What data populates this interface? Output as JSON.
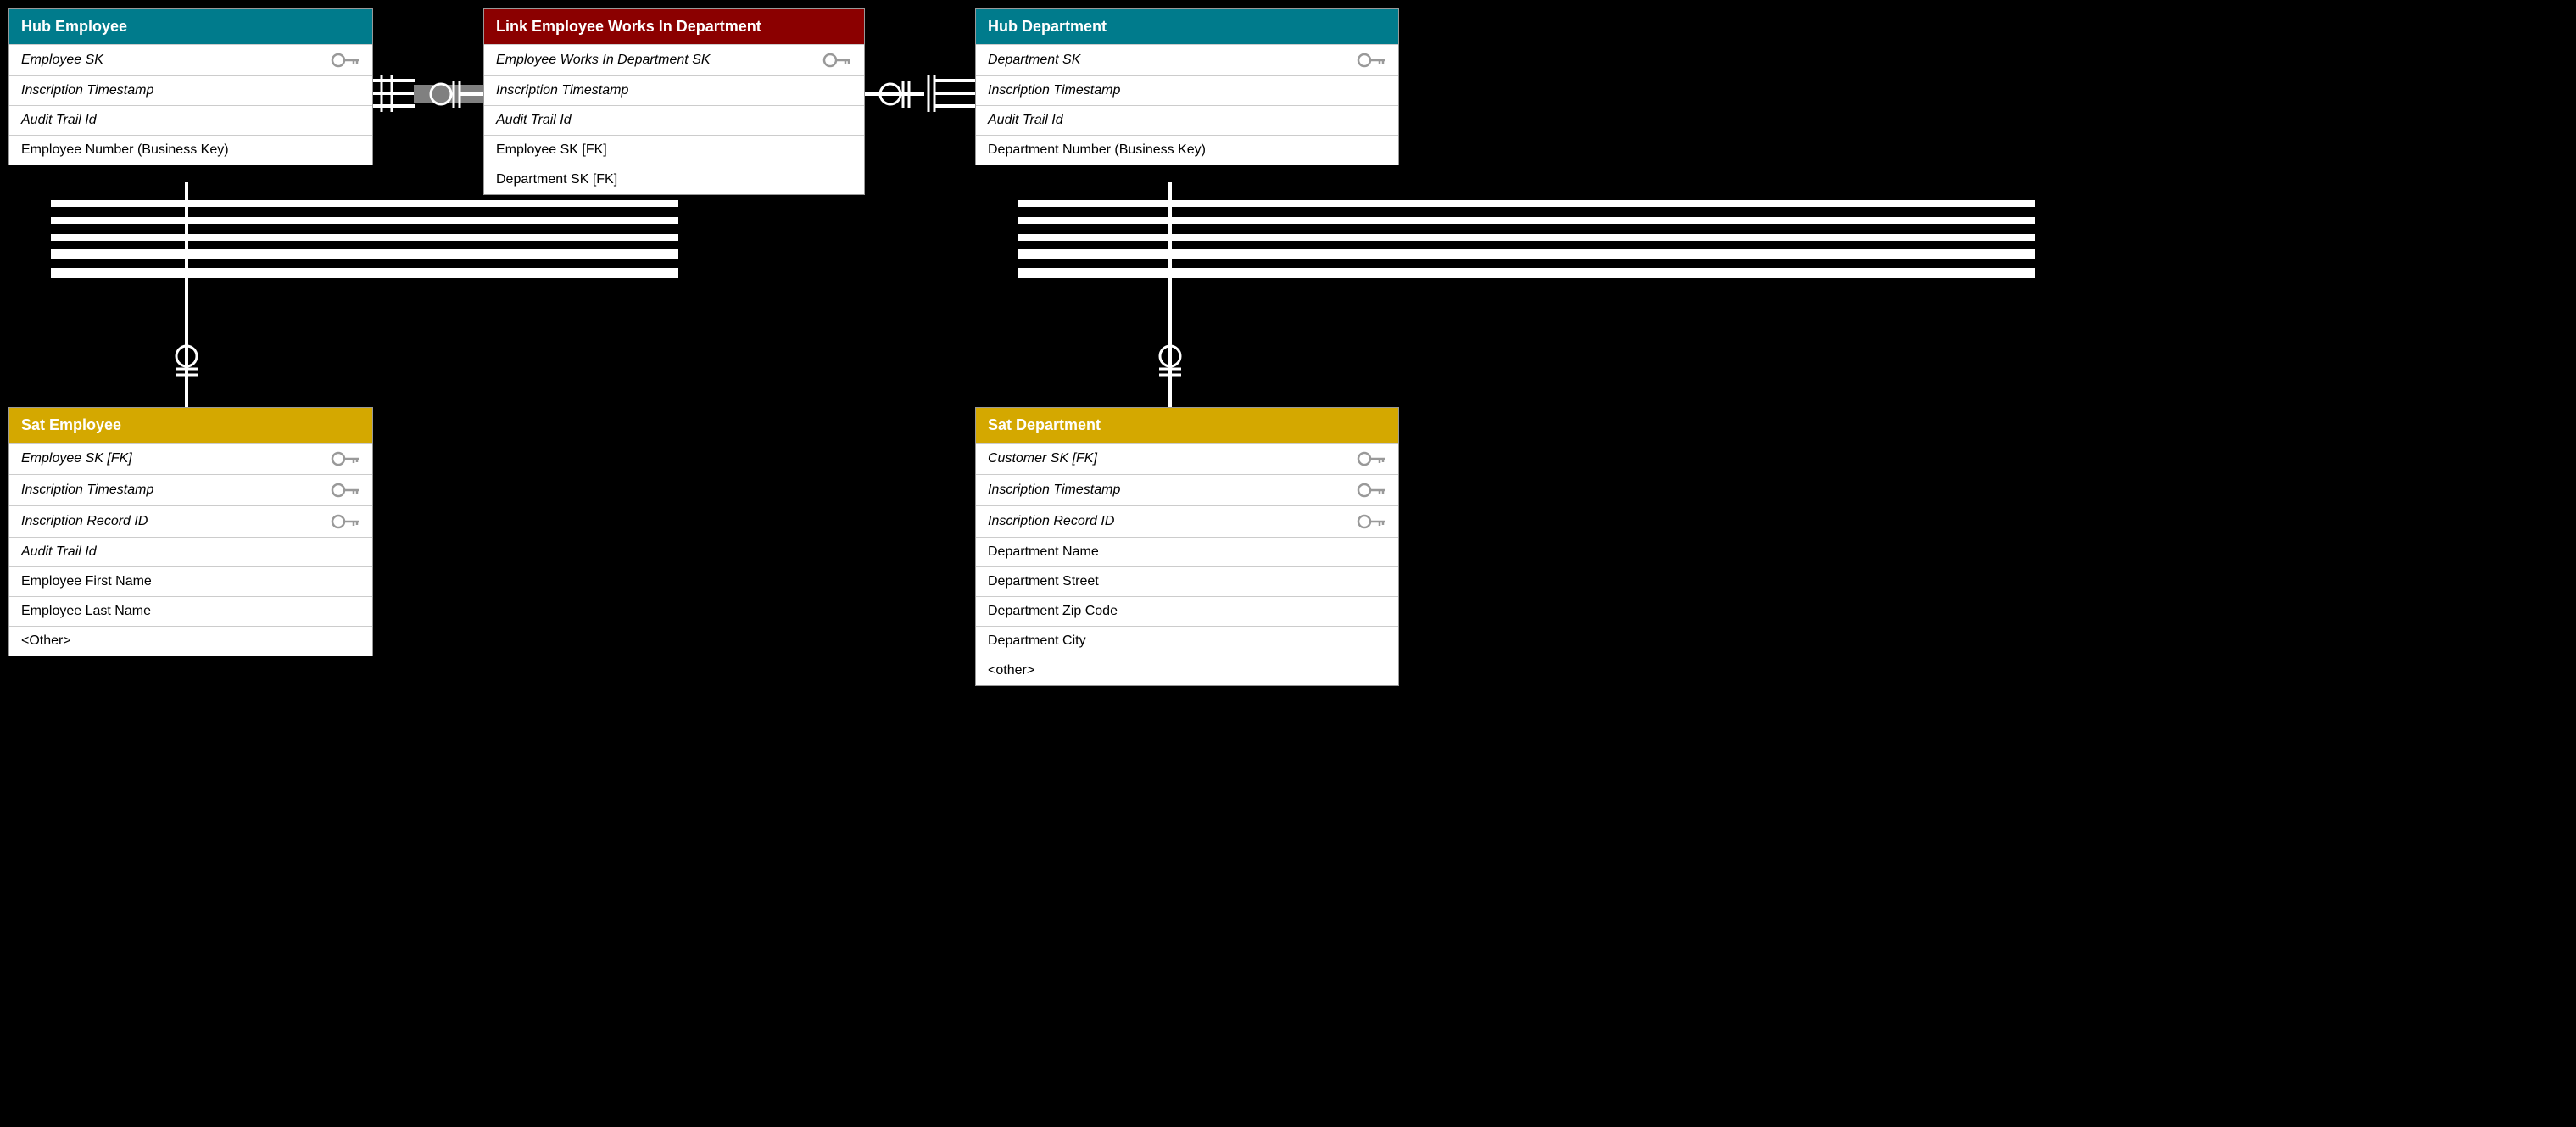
{
  "hubEmployee": {
    "title": "Hub Employee",
    "headerColor": "#007b8c",
    "fields": [
      {
        "label": "Employee SK",
        "hasKey": true
      },
      {
        "label": "Inscription Timestamp",
        "hasKey": false
      },
      {
        "label": "Audit Trail Id",
        "hasKey": false
      },
      {
        "label": "Employee Number (Business Key)",
        "hasKey": false,
        "normal": true
      }
    ]
  },
  "linkEmployee": {
    "title": "Link Employee Works In Department",
    "headerColor": "#8b0000",
    "fields": [
      {
        "label": "Employee Works In Department SK",
        "hasKey": true
      },
      {
        "label": "Inscription Timestamp",
        "hasKey": false
      },
      {
        "label": "Audit Trail Id",
        "hasKey": false
      },
      {
        "label": "Employee SK [FK]",
        "hasKey": false,
        "normal": true
      },
      {
        "label": "Department SK [FK]",
        "hasKey": false,
        "normal": true
      }
    ]
  },
  "hubDepartment": {
    "title": "Hub Department",
    "headerColor": "#007b8c",
    "fields": [
      {
        "label": "Department SK",
        "hasKey": true
      },
      {
        "label": "Inscription Timestamp",
        "hasKey": false
      },
      {
        "label": "Audit Trail Id",
        "hasKey": false
      },
      {
        "label": "Department Number (Business Key)",
        "hasKey": false,
        "normal": true
      }
    ]
  },
  "satEmployee": {
    "title": "Sat Employee",
    "headerColor": "#d4a800",
    "fields": [
      {
        "label": "Employee SK [FK]",
        "hasKey": true
      },
      {
        "label": "Inscription Timestamp",
        "hasKey": true
      },
      {
        "label": "Inscription Record ID",
        "hasKey": true
      },
      {
        "label": "Audit Trail Id",
        "hasKey": false
      },
      {
        "label": "Employee First Name",
        "hasKey": false,
        "normal": true
      },
      {
        "label": "Employee Last Name",
        "hasKey": false,
        "normal": true
      },
      {
        "label": "<Other>",
        "hasKey": false,
        "normal": true
      }
    ]
  },
  "satDepartment": {
    "title": "Sat Department",
    "headerColor": "#d4a800",
    "fields": [
      {
        "label": "Customer SK [FK]",
        "hasKey": true
      },
      {
        "label": "Inscription Timestamp",
        "hasKey": true
      },
      {
        "label": "Inscription Record ID",
        "hasKey": true
      },
      {
        "label": "Department Name",
        "hasKey": false,
        "normal": true
      },
      {
        "label": "Department Street",
        "hasKey": false,
        "normal": true
      },
      {
        "label": "Department Zip Code",
        "hasKey": false,
        "normal": true
      },
      {
        "label": "Department City",
        "hasKey": false,
        "normal": true
      },
      {
        "label": "<other>",
        "hasKey": false,
        "normal": true
      }
    ]
  }
}
